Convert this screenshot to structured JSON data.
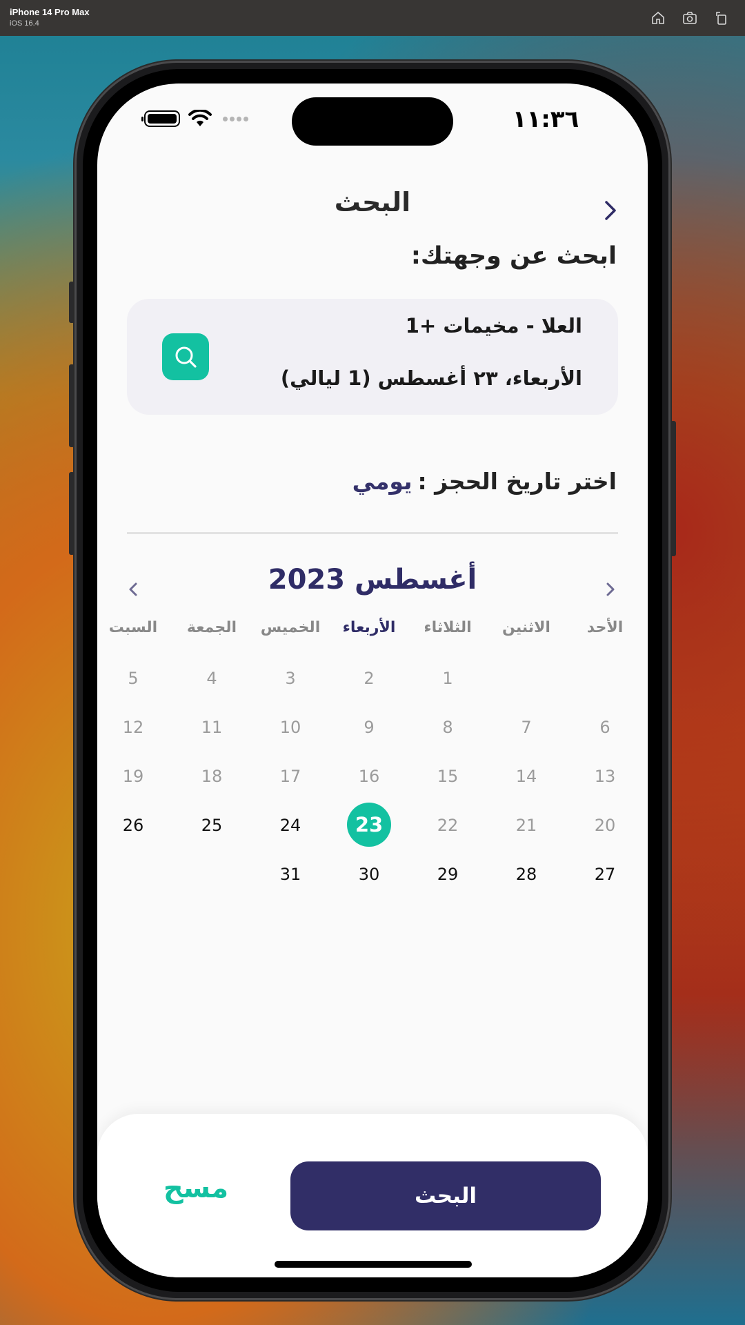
{
  "simulator": {
    "device_name": "iPhone 14 Pro Max",
    "os_version": "iOS 16.4",
    "icons": [
      "home-icon",
      "screenshot-icon",
      "rotate-icon"
    ]
  },
  "status_bar": {
    "time": "١١:٣٦",
    "icons": [
      "battery-icon",
      "wifi-icon",
      "signal-icon"
    ]
  },
  "header": {
    "title": "البحث",
    "back_icon": "chevron-right-icon"
  },
  "destination_section": {
    "title": "ابحث عن وجهتك:"
  },
  "search_card": {
    "destination": "العلا - مخيمات +1",
    "date_range": "الأربعاء، ٢٣ أغسطس (1 ليالي)",
    "search_icon": "search-icon",
    "accent_color": "#13c1a1"
  },
  "booking": {
    "label": "اختر تاريخ الحجز :",
    "type": "يومي"
  },
  "calendar": {
    "month_title": "أغسطس 2023",
    "weekdays": [
      "الأحد",
      "الاثنين",
      "الثلاثاء",
      "الأربعاء",
      "الخميس",
      "الجمعة",
      "السبت"
    ],
    "active_weekday_index": 3,
    "weeks": [
      [
        "",
        "",
        "1",
        "2",
        "3",
        "4",
        "5"
      ],
      [
        "6",
        "7",
        "8",
        "9",
        "10",
        "11",
        "12"
      ],
      [
        "13",
        "14",
        "15",
        "16",
        "17",
        "18",
        "19"
      ],
      [
        "20",
        "21",
        "22",
        "23",
        "24",
        "25",
        "26"
      ],
      [
        "27",
        "28",
        "29",
        "30",
        "31",
        "",
        ""
      ]
    ],
    "selected_day": "23",
    "first_available_day": 24,
    "selected_color": "#13c1a1",
    "header_color": "#2f2c66"
  },
  "footer": {
    "search_button": "البحث",
    "clear_button": "مسح",
    "primary_color": "#312e67"
  }
}
